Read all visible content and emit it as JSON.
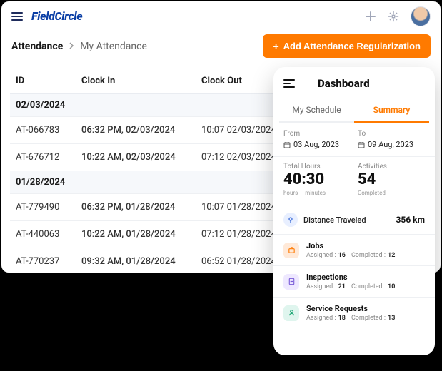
{
  "logo": "FieldCircle",
  "breadcrumb": {
    "root": "Attendance",
    "current": "My Attendance"
  },
  "add_button": "Add Attendance Regularization",
  "table": {
    "headers": {
      "id": "ID",
      "clock_in": "Clock In",
      "clock_out": "Clock Out"
    },
    "groups": [
      {
        "date": "02/03/2024",
        "rows": [
          {
            "id": "AT-066783",
            "in": "06:32 PM, 02/03/2024",
            "out": "10:07 02/03/2024"
          },
          {
            "id": "AT-676712",
            "in": "10:22 AM, 02/03/2024",
            "out": "07:12 02/03/2024"
          }
        ]
      },
      {
        "date": "01/28/2024",
        "rows": [
          {
            "id": "AT-779490",
            "in": "06:32 PM, 01/28/2024",
            "out": "10:07 01/28/2024"
          },
          {
            "id": "AT-440063",
            "in": "10:22 AM, 01/28/2024",
            "out": "07:12 01/28/2024"
          },
          {
            "id": "AT-770237",
            "in": "09:32 AM, 01/28/2024",
            "out": "06:52 01/28/2024"
          }
        ]
      }
    ]
  },
  "dashboard": {
    "title": "Dashboard",
    "tabs": {
      "schedule": "My Schedule",
      "summary": "Summary"
    },
    "from_label": "From",
    "from_value": "03 Aug, 2023",
    "to_label": "To",
    "to_value": "09 Aug, 2023",
    "total_hours_label": "Total Hours",
    "total_hours_value": "40:30",
    "hours_word": "hours",
    "minutes_word": "minutes",
    "activities_label": "Activities",
    "activities_value": "54",
    "completed_word": "Completed",
    "distance_label": "Distance Traveled",
    "distance_value": "356 km",
    "items": [
      {
        "title": "Jobs",
        "assigned_label": "Assigned :",
        "assigned": "16",
        "completed_label": "Completed :",
        "completed": "12"
      },
      {
        "title": "Inspections",
        "assigned_label": "Assigned :",
        "assigned": "21",
        "completed_label": "Completed :",
        "completed": "10"
      },
      {
        "title": "Service Requests",
        "assigned_label": "Assigned :",
        "assigned": "18",
        "completed_label": "Completed :",
        "completed": "13"
      }
    ]
  }
}
